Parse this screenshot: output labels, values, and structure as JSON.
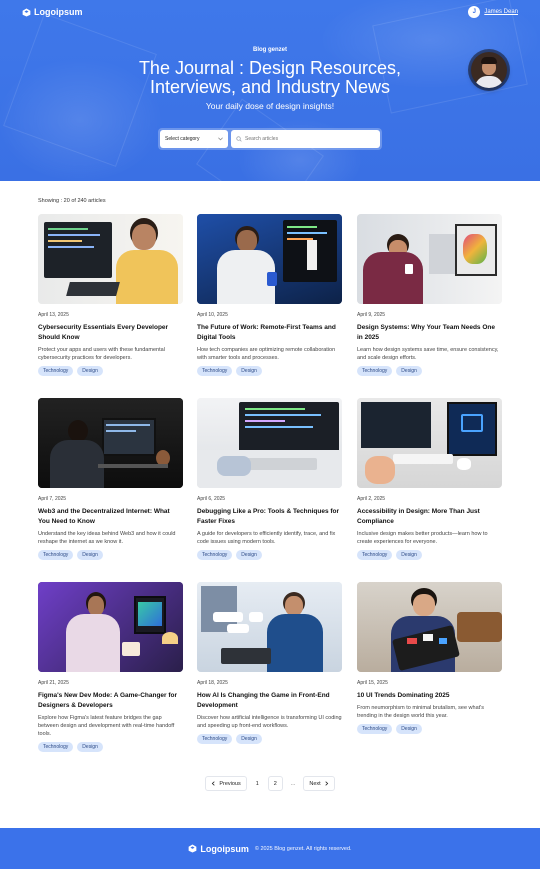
{
  "header": {
    "brand": "Logoipsum",
    "user_initial": "J",
    "user_name": "James Dean",
    "eyebrow": "Blog genzet",
    "title_line1": "The Journal : Design Resources,",
    "title_line2": "Interviews, and Industry News",
    "subtitle": "Your daily dose of design insights!",
    "category_select": "Select category",
    "search_placeholder": "Search articles"
  },
  "listing": {
    "showing": "Showing : 20 of 240 articles"
  },
  "articles": [
    {
      "date": "April 13, 2025",
      "title": "Cybersecurity Essentials Every Developer Should Know",
      "excerpt": "Protect your apps and users with these fundamental cybersecurity practices for developers.",
      "tags": [
        "Technology",
        "Design"
      ]
    },
    {
      "date": "April 10, 2025",
      "title": "The Future of Work: Remote-First Teams and Digital Tools",
      "excerpt": "How tech companies are optimizing remote collaboration with smarter tools and processes.",
      "tags": [
        "Technology",
        "Design"
      ]
    },
    {
      "date": "April 9, 2025",
      "title": "Design Systems: Why Your Team Needs One in 2025",
      "excerpt": "Learn how design systems save time, ensure consistency, and scale design efforts.",
      "tags": [
        "Technology",
        "Design"
      ]
    },
    {
      "date": "April 7, 2025",
      "title": "Web3 and the Decentralized Internet: What You Need to Know",
      "excerpt": "Understand the key ideas behind Web3 and how it could reshape the internet as we know it.",
      "tags": [
        "Technology",
        "Design"
      ]
    },
    {
      "date": "April 6, 2025",
      "title": "Debugging Like a Pro: Tools & Techniques for Faster Fixes",
      "excerpt": "A guide for developers to efficiently identify, trace, and fix code issues using modern tools.",
      "tags": [
        "Technology",
        "Design"
      ]
    },
    {
      "date": "April 2, 2025",
      "title": "Accessibility in Design: More Than Just Compliance",
      "excerpt": "Inclusive design makes better products—learn how to create experiences for everyone.",
      "tags": [
        "Technology",
        "Design"
      ]
    },
    {
      "date": "April 21, 2025",
      "title": "Figma's New Dev Mode: A Game-Changer for Designers & Developers",
      "excerpt": "Explore how Figma's latest feature bridges the gap between design and development with real-time handoff tools.",
      "tags": [
        "Technology",
        "Design"
      ]
    },
    {
      "date": "April 18, 2025",
      "title": "How AI Is Changing the Game in Front-End Development",
      "excerpt": "Discover how artificial intelligence is transforming UI coding and speeding up front-end workflows.",
      "tags": [
        "Technology",
        "Design"
      ]
    },
    {
      "date": "April 15, 2025",
      "title": "10 UI Trends Dominating 2025",
      "excerpt": "From neumorphism to minimal brutalism, see what's trending in the design world this year.",
      "tags": [
        "Technology",
        "Design"
      ]
    }
  ],
  "pagination": {
    "previous": "Previous",
    "pages": [
      "1",
      "2"
    ],
    "ellipsis": "...",
    "next": "Next"
  },
  "footer": {
    "brand": "Logoipsum",
    "copyright": "© 2025 Blog genzet. All rights reserved."
  },
  "colors": {
    "primary": "#3b72ea",
    "tag_bg": "#d6e4fb",
    "tag_text": "#2d4a86"
  }
}
